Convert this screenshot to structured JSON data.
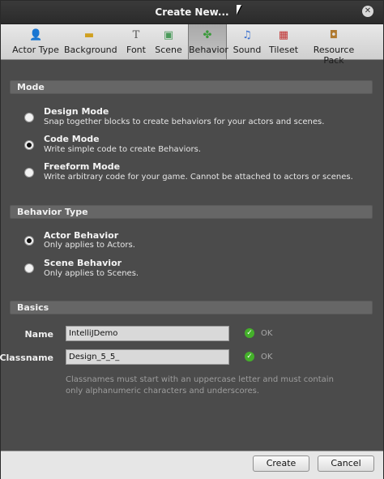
{
  "window": {
    "title": "Create New..."
  },
  "toolbar": {
    "items": [
      {
        "label": "Actor Type",
        "icon": "actor-icon",
        "glyph": "👤"
      },
      {
        "label": "Background",
        "icon": "background-icon",
        "glyph": "▬"
      },
      {
        "label": "Font",
        "icon": "font-icon",
        "glyph": "T"
      },
      {
        "label": "Scene",
        "icon": "scene-icon",
        "glyph": "▣"
      },
      {
        "label": "Behavior",
        "icon": "behavior-icon",
        "glyph": "✤"
      },
      {
        "label": "Sound",
        "icon": "sound-icon",
        "glyph": "♫"
      },
      {
        "label": "Tileset",
        "icon": "tileset-icon",
        "glyph": "▦"
      },
      {
        "label": "Resource Pack",
        "icon": "resource-pack-icon",
        "glyph": "◘"
      }
    ],
    "active": "Behavior"
  },
  "mode": {
    "header": "Mode",
    "options": [
      {
        "title": "Design Mode",
        "desc": "Snap together blocks to create behaviors for your actors and scenes.",
        "selected": false
      },
      {
        "title": "Code Mode",
        "desc": "Write simple code to create Behaviors.",
        "selected": true
      },
      {
        "title": "Freeform Mode",
        "desc": "Write arbitrary code for your game. Cannot be attached to actors or scenes.",
        "selected": false
      }
    ]
  },
  "behavior_type": {
    "header": "Behavior Type",
    "options": [
      {
        "title": "Actor Behavior",
        "desc": "Only applies to Actors.",
        "selected": true
      },
      {
        "title": "Scene Behavior",
        "desc": "Only applies to Scenes.",
        "selected": false
      }
    ]
  },
  "basics": {
    "header": "Basics",
    "name_label": "Name",
    "name_value": "IntelliJDemo",
    "name_status": "OK",
    "classname_label": "Classname",
    "classname_value": "Design_5_5_",
    "classname_status": "OK",
    "hint": "Classnames must start with an uppercase letter and must contain only alphanumeric characters and underscores."
  },
  "footer": {
    "create_label": "Create",
    "cancel_label": "Cancel"
  },
  "colors": {
    "ok_green": "#44b02a",
    "panel_bg": "#4b4b4b"
  }
}
